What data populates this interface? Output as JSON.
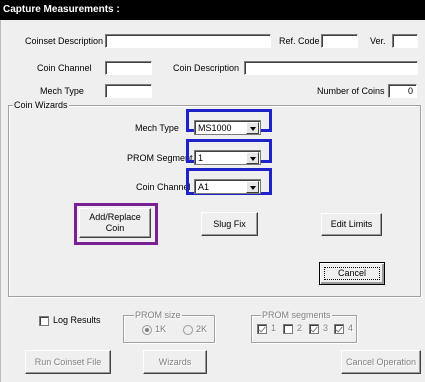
{
  "window": {
    "title": "Capture Measurements :"
  },
  "coinset": {
    "description_label": "Coinset Description",
    "description_value": "",
    "ref_code_label": "Ref. Code",
    "ref_code_value": "",
    "ver_label": "Ver.",
    "ver_value": "",
    "coin_channel_label": "Coin Channel",
    "coin_channel_value": "",
    "coin_description_label": "Coin Description",
    "coin_description_value": "",
    "mech_type_label": "Mech Type",
    "mech_type_value": "",
    "number_of_coins_label": "Number of Coins",
    "number_of_coins_value": "0"
  },
  "coin_wizards": {
    "group_label": "Coin Wizards",
    "mech_type_label": "Mech Type",
    "mech_type_value": "MS1000",
    "prom_segment_label": "PROM Segment",
    "prom_segment_value": "1",
    "coin_channel_label": "Coin Channel",
    "coin_channel_value": "A1",
    "add_replace_line1": "Add/Replace",
    "add_replace_line2": "Coin",
    "slug_fix_label": "Slug Fix",
    "edit_limits_label": "Edit Limits",
    "cancel_label": "Cancel"
  },
  "options": {
    "log_results_label": "Log Results",
    "log_results_checked": false,
    "prom_size_label": "PROM size",
    "prom_size_options": [
      "1K",
      "2K"
    ],
    "prom_size_selected": "1K",
    "prom_segments_label": "PROM segments",
    "prom_segments": [
      {
        "label": "1",
        "checked": true
      },
      {
        "label": "2",
        "checked": false
      },
      {
        "label": "3",
        "checked": true
      },
      {
        "label": "4",
        "checked": true
      }
    ]
  },
  "footer": {
    "run_coinset_label": "Run Coinset File",
    "wizards_label": "Wizards",
    "cancel_operation_label": "Cancel Operation"
  },
  "highlight_colors": {
    "blue": "#1f22c8",
    "purple": "#7a1f94"
  }
}
